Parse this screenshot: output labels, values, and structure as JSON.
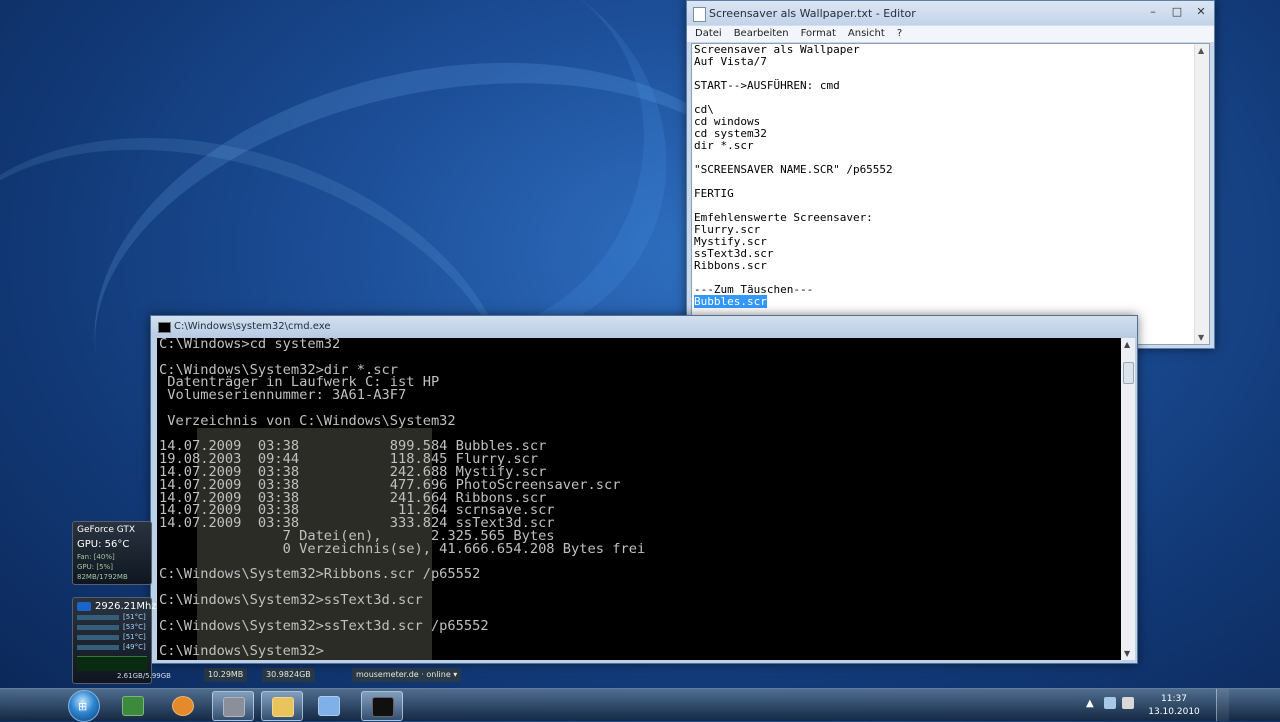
{
  "notepad": {
    "title": "Screensaver als Wallpaper.txt - Editor",
    "controls": {
      "minimize": "–",
      "maximize": "□",
      "close": "✕"
    },
    "menu": [
      "Datei",
      "Bearbeiten",
      "Format",
      "Ansicht",
      "?"
    ],
    "lines": [
      "Screensaver als Wallpaper",
      "Auf Vista/7",
      "",
      "START-->AUSFÜHREN: cmd",
      "",
      "cd\\",
      "cd windows",
      "cd system32",
      "dir *.scr",
      "",
      "\"SCREENSAVER NAME.SCR\" /p65552",
      "",
      "FERTIG",
      "",
      "Emfehlenswerte Screensaver:",
      "Flurry.scr",
      "Mystify.scr",
      "ssText3d.scr",
      "Ribbons.scr",
      "",
      "---Zum Täuschen---"
    ],
    "selected_line": "Bubbles.scr"
  },
  "cmd": {
    "title": "C:\\Windows\\system32\\cmd.exe",
    "lines": [
      "C:\\Windows>cd system32",
      "",
      "C:\\Windows\\System32>dir *.scr",
      " Datenträger in Laufwerk C: ist HP",
      " Volumeseriennummer: 3A61-A3F7",
      "",
      " Verzeichnis von C:\\Windows\\System32",
      "",
      "14.07.2009  03:38           899.584 Bubbles.scr",
      "19.08.2003  09:44           118.845 Flurry.scr",
      "14.07.2009  03:38           242.688 Mystify.scr",
      "14.07.2009  03:38           477.696 PhotoScreensaver.scr",
      "14.07.2009  03:38           241.664 Ribbons.scr",
      "14.07.2009  03:38            11.264 scrnsave.scr",
      "14.07.2009  03:38           333.824 ssText3d.scr",
      "               7 Datei(en),      2.325.565 Bytes",
      "               0 Verzeichnis(se), 41.666.654.208 Bytes frei",
      "",
      "C:\\Windows\\System32>Ribbons.scr /p65552",
      "",
      "C:\\Windows\\System32>ssText3d.scr",
      "",
      "C:\\Windows\\System32>ssText3d.scr /p65552",
      "",
      "C:\\Windows\\System32>"
    ]
  },
  "gadgets": {
    "gpu": {
      "name": "GeForce GTX",
      "temp": "GPU: 56°C",
      "fan": "Fan: [40%]",
      "load": "GPU: [5%]",
      "mem": "82MB/1792MB"
    },
    "cpu": {
      "clock": "2926.21Mhz",
      "core_temps": [
        "[51°C]",
        "[53°C]",
        "[51°C]",
        "[49°C]"
      ],
      "mem": "2.61GB/5.99GB"
    }
  },
  "background_stats": [
    "10.29MB",
    "30.9824GB",
    "mousemeter.de · online ▾"
  ],
  "taskbar": {
    "pinned": [
      {
        "name": "computer",
        "color": "#3c8b3c"
      },
      {
        "name": "firefox",
        "color": "#e58a2a"
      },
      {
        "name": "hardware-tool",
        "color": "#8a8f99"
      },
      {
        "name": "explorer",
        "color": "#e8c45a"
      },
      {
        "name": "slide-tool",
        "color": "#7fb0e8"
      },
      {
        "name": "cmd",
        "color": "#101010"
      }
    ],
    "clock": {
      "time": "11:37",
      "date": "13.10.2010"
    }
  }
}
